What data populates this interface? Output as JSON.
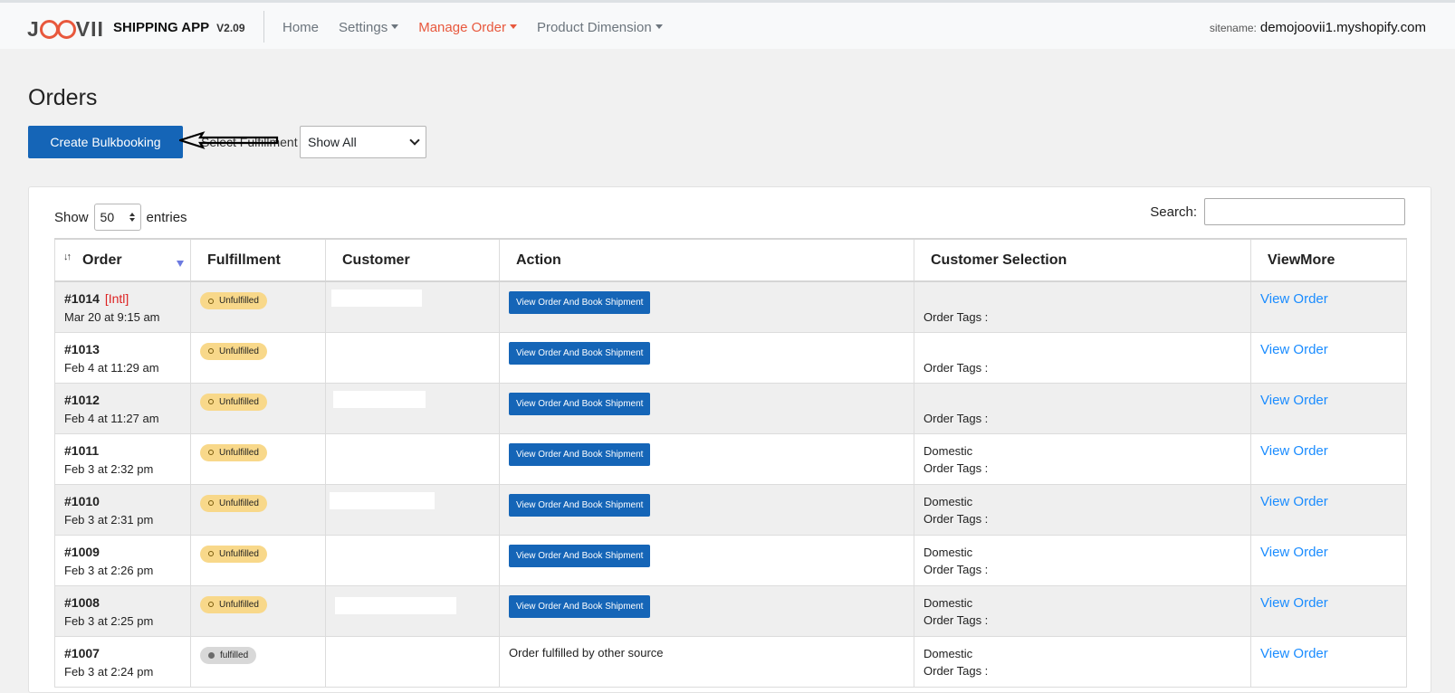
{
  "nav": {
    "logo": "JOOVII",
    "app_name": "SHIPPING APP",
    "version": "V2.09",
    "items": [
      {
        "label": "Home",
        "dropdown": false,
        "active": false
      },
      {
        "label": "Settings",
        "dropdown": true,
        "active": false
      },
      {
        "label": "Manage Order",
        "dropdown": true,
        "active": true
      },
      {
        "label": "Product Dimension",
        "dropdown": true,
        "active": false
      }
    ],
    "sitename_label": "sitename:",
    "sitename_value": "demojoovii1.myshopify.com"
  },
  "page": {
    "title": "Orders",
    "bulk_button": "Create Bulkbooking",
    "fulfillment_label": "Select Fulfillment",
    "fulfillment_selected": "Show All"
  },
  "table_controls": {
    "show_label": "Show",
    "entries_value": "50",
    "entries_label": "entries",
    "search_label": "Search:"
  },
  "columns": [
    "Order",
    "Fulfillment",
    "Customer",
    "Action",
    "Customer Selection",
    "ViewMore"
  ],
  "rows": [
    {
      "order": "#1014",
      "intl": "[Intl]",
      "date": "Mar 20 at 9:15 am",
      "fulfillment": "Unfulfilled",
      "action": "View Order And Book Shipment",
      "selection": "",
      "tags": "Order Tags :",
      "view": "View Order"
    },
    {
      "order": "#1013",
      "intl": "",
      "date": "Feb 4 at 11:29 am",
      "fulfillment": "Unfulfilled",
      "action": "View Order And Book Shipment",
      "selection": "",
      "tags": "Order Tags :",
      "view": "View Order"
    },
    {
      "order": "#1012",
      "intl": "",
      "date": "Feb 4 at 11:27 am",
      "fulfillment": "Unfulfilled",
      "action": "View Order And Book Shipment",
      "selection": "",
      "tags": "Order Tags :",
      "view": "View Order"
    },
    {
      "order": "#1011",
      "intl": "",
      "date": "Feb 3 at 2:32 pm",
      "fulfillment": "Unfulfilled",
      "action": "View Order And Book Shipment",
      "selection": "Domestic",
      "tags": "Order Tags :",
      "view": "View Order"
    },
    {
      "order": "#1010",
      "intl": "",
      "date": "Feb 3 at 2:31 pm",
      "fulfillment": "Unfulfilled",
      "action": "View Order And Book Shipment",
      "selection": "Domestic",
      "tags": "Order Tags :",
      "view": "View Order"
    },
    {
      "order": "#1009",
      "intl": "",
      "date": "Feb 3 at 2:26 pm",
      "fulfillment": "Unfulfilled",
      "action": "View Order And Book Shipment",
      "selection": "Domestic",
      "tags": "Order Tags :",
      "view": "View Order"
    },
    {
      "order": "#1008",
      "intl": "",
      "date": "Feb 3 at 2:25 pm",
      "fulfillment": "Unfulfilled",
      "action": "View Order And Book Shipment",
      "selection": "Domestic",
      "tags": "Order Tags :",
      "view": "View Order"
    },
    {
      "order": "#1007",
      "intl": "",
      "date": "Feb 3 at 2:24 pm",
      "fulfillment": "fulfilled",
      "action": "Order fulfilled by other source",
      "selection": "Domestic",
      "tags": "Order Tags :",
      "view": "View Order"
    }
  ],
  "colors": {
    "brand": "#e8583d",
    "primary": "#1565b7",
    "link": "#1a8cff",
    "unfulfilled_badge": "#f8d88a",
    "fulfilled_badge": "#d8d8d8"
  }
}
